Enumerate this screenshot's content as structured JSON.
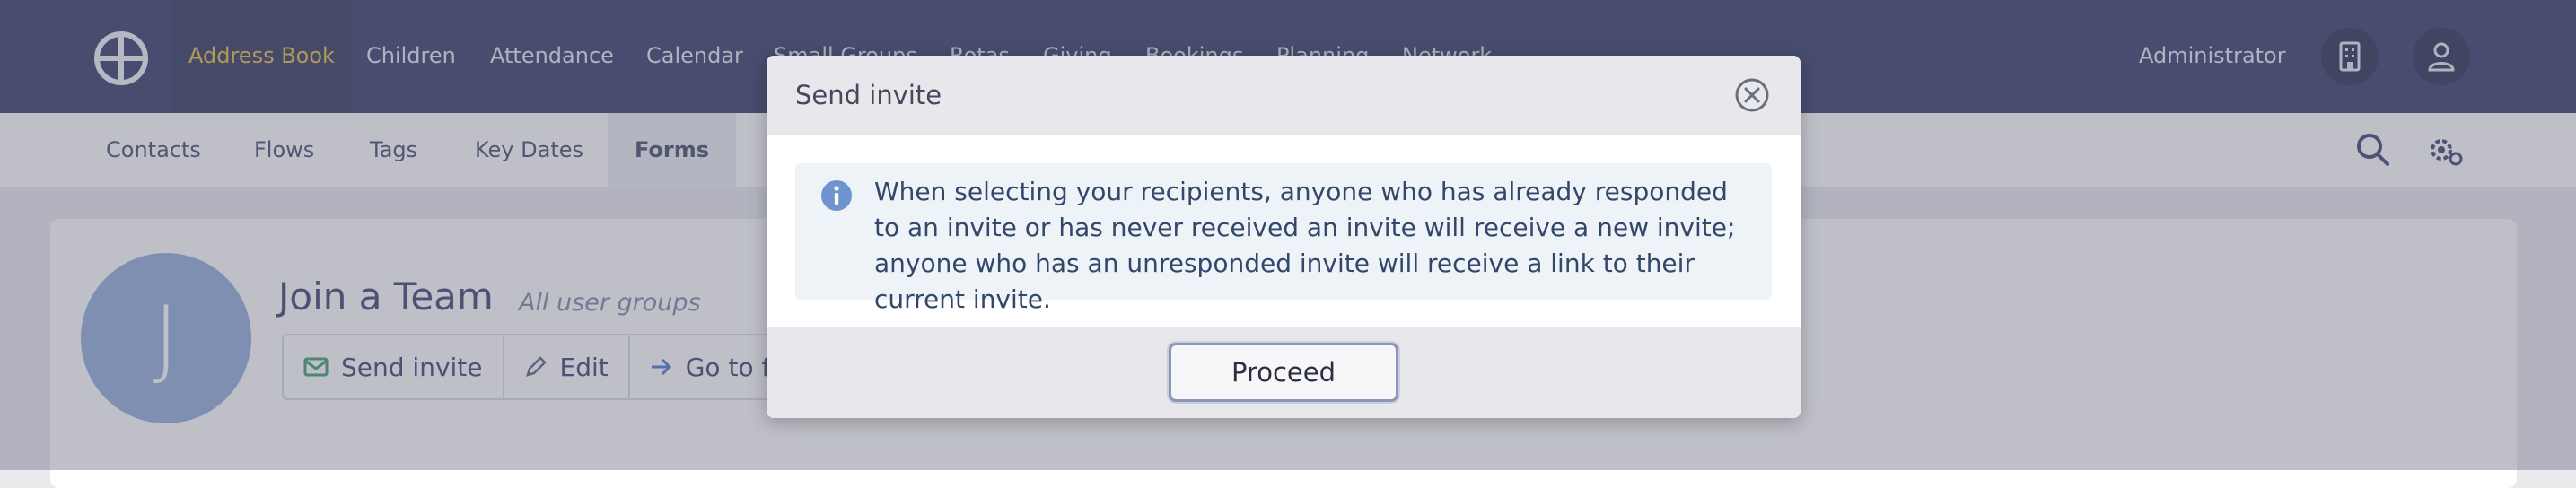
{
  "topnav": {
    "items": [
      "Address Book",
      "Children",
      "Attendance",
      "Calendar",
      "Small Groups",
      "Rotas",
      "Giving",
      "Bookings",
      "Planning",
      "Network"
    ],
    "active_item": "Address Book",
    "user_label": "Administrator",
    "icons": [
      "building-icon",
      "user-icon"
    ]
  },
  "subnav": {
    "items": [
      "Contacts",
      "Flows",
      "Tags",
      "Key Dates",
      "Forms"
    ],
    "active_item": "Forms",
    "icons": [
      "search-icon",
      "settings-icon"
    ]
  },
  "page": {
    "avatar_letter": "J",
    "title": "Join a Team",
    "subtitle": "All user groups",
    "actions": [
      "Send invite",
      "Edit",
      "Go to f"
    ]
  },
  "modal": {
    "title": "Send invite",
    "info_text": "When selecting your recipients, anyone who has already responded to an invite or has never received an invite will receive a new invite; anyone who has an unresponded invite will receive a link to their current invite.",
    "proceed_label": "Proceed"
  },
  "colors": {
    "topbar": "#292e5e",
    "active_nav_text": "#e5b63a",
    "avatar": "#8aa8d9",
    "info_icon": "#6f93cf"
  }
}
